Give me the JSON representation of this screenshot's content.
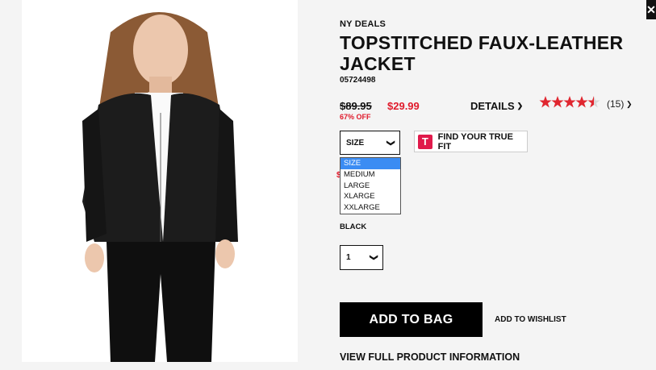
{
  "product": {
    "brand": "NY DEALS",
    "title": "TOPSTITCHED FAUX-LEATHER JACKET",
    "sku": "05724498",
    "old_price": "$89.95",
    "new_price": "$29.99",
    "discount": "67% OFF",
    "details_label": "DETAILS",
    "rating": 4.5,
    "review_count": "(15)"
  },
  "size": {
    "label": "SIZE",
    "options": [
      "SIZE",
      "MEDIUM",
      "LARGE",
      "XLARGE",
      "XXLARGE"
    ],
    "selected": "SIZE"
  },
  "truefit": {
    "logo": "T",
    "label": "FIND YOUR TRUE FIT"
  },
  "color": {
    "label": "BLACK"
  },
  "quantity": {
    "value": "1"
  },
  "actions": {
    "add_to_bag": "ADD TO BAG",
    "wishlist": "ADD TO WISHLIST",
    "view_full": "VIEW FULL PRODUCT INFORMATION"
  },
  "colors": {
    "sale_red": "#e01a2b",
    "star_red": "#e0262f",
    "highlight_blue": "#3b8cf3"
  },
  "icons": {
    "close": "close-icon",
    "chevron": "chevron-down-icon"
  }
}
